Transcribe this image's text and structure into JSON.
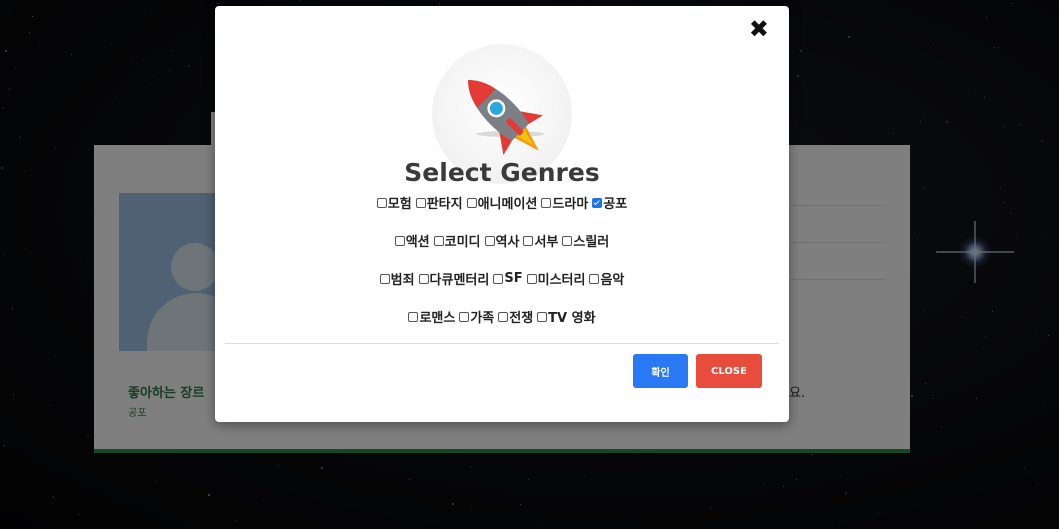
{
  "background": {
    "favorite_genre_label": "좋아하는 장르",
    "favorite_genre_value": "공포",
    "trailing_text": "요."
  },
  "modal": {
    "close_icon": "✖",
    "logo_icon": "rocket-icon",
    "title": "Select Genres",
    "genre_rows": [
      [
        {
          "label": "모험",
          "checked": false
        },
        {
          "label": "판타지",
          "checked": false
        },
        {
          "label": "애니메이션",
          "checked": false
        },
        {
          "label": "드라마",
          "checked": false
        },
        {
          "label": "공포",
          "checked": true
        }
      ],
      [
        {
          "label": "액션",
          "checked": false
        },
        {
          "label": "코미디",
          "checked": false
        },
        {
          "label": "역사",
          "checked": false
        },
        {
          "label": "서부",
          "checked": false
        },
        {
          "label": "스릴러",
          "checked": false
        }
      ],
      [
        {
          "label": "범죄",
          "checked": false
        },
        {
          "label": "다큐멘터리",
          "checked": false
        },
        {
          "label": "SF",
          "checked": false
        },
        {
          "label": "미스터리",
          "checked": false
        },
        {
          "label": "음악",
          "checked": false
        }
      ],
      [
        {
          "label": "로맨스",
          "checked": false
        },
        {
          "label": "가족",
          "checked": false
        },
        {
          "label": "전쟁",
          "checked": false
        },
        {
          "label": "TV 영화",
          "checked": false
        }
      ]
    ],
    "confirm_label": "확인",
    "close_label": "CLOSE",
    "colors": {
      "confirm": "#2979f5",
      "close": "#e74c3c"
    }
  }
}
